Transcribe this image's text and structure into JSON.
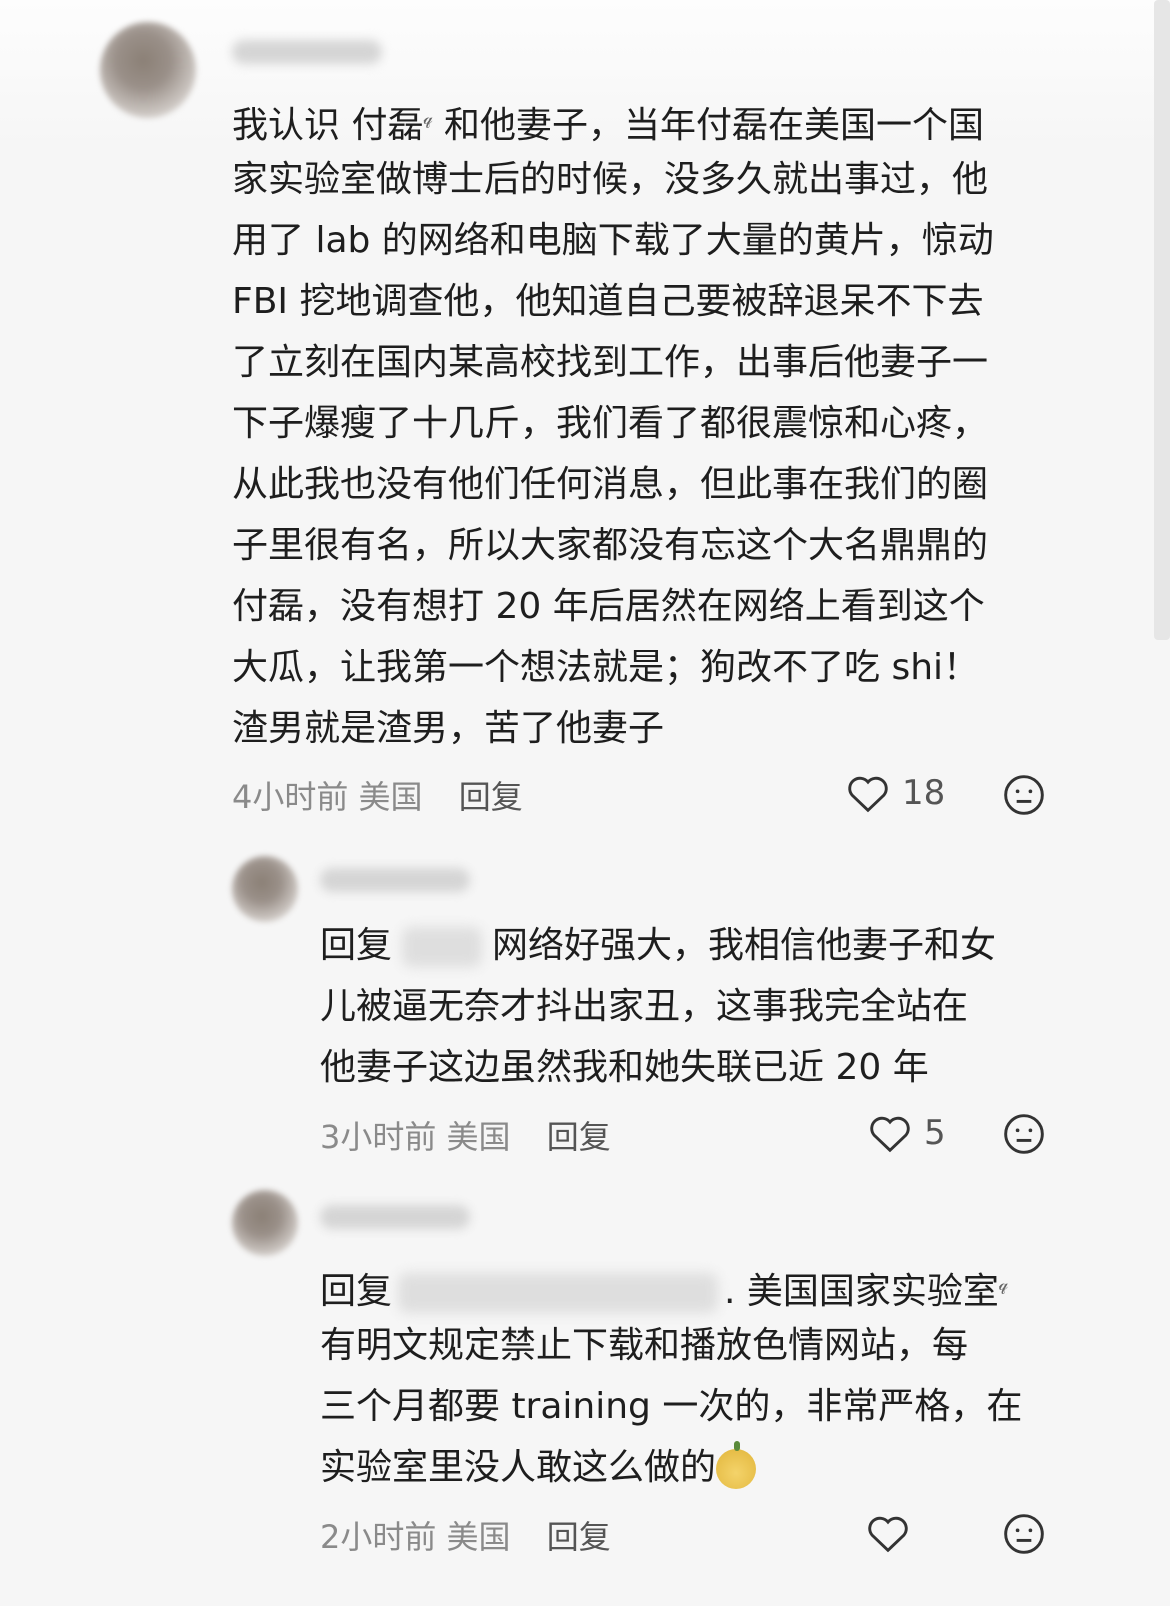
{
  "comments": [
    {
      "lines": [
        "我认识 付磊",
        "家实验室做博士后的时候，没多久就出事过，他",
        "用了 lab 的网络和电脑下载了大量的黄片，惊动",
        "FBI 挖地调查他，他知道自己要被辞退呆不下去",
        "了立刻在国内某高校找到工作，出事后他妻子一",
        "下子爆瘦了十几斤，我们看了都很震惊和心疼，",
        "从此我也没有他们任何消息，但此事在我们的圈",
        "子里很有名，所以大家都没有忘这个大名鼎鼎的",
        "付磊，没有想打 20 年后居然在网络上看到这个",
        "大瓜，让我第一个想法就是；狗改不了吃 shi！",
        "渣男就是渣男，苦了他妻子"
      ],
      "line1_tail": " 和他妻子，当年付磊在美国一个国",
      "time": "4小时前",
      "region": "美国",
      "reply_label": "回复",
      "likes": "18"
    },
    {
      "reply_prefix": "回复",
      "line1_tail": "网络好强大，我相信他妻子和女",
      "lines": [
        "儿被逼无奈才抖出家丑，这事我完全站在",
        "他妻子这边虽然我和她失联已近 20 年"
      ],
      "time": "3小时前",
      "region": "美国",
      "reply_label": "回复",
      "likes": "5"
    },
    {
      "reply_prefix": "回复",
      "line1_tail": ". 美国国家实验室",
      "lines": [
        "有明文规定禁止下载和播放色情网站，每",
        "三个月都要 training 一次的，非常严格，在",
        "实验室里没人敢这么做的"
      ],
      "time": "2小时前",
      "region": "美国",
      "reply_label": "回复",
      "likes": ""
    }
  ],
  "icons": {
    "like": "heart-icon",
    "dislike": "meh-face-icon",
    "search_hint": "search-icon",
    "emoji": "pear-emoji-icon"
  },
  "colors": {
    "background": "#f6f6f6",
    "text": "#1e1e1e",
    "meta": "#8a8a8a"
  }
}
